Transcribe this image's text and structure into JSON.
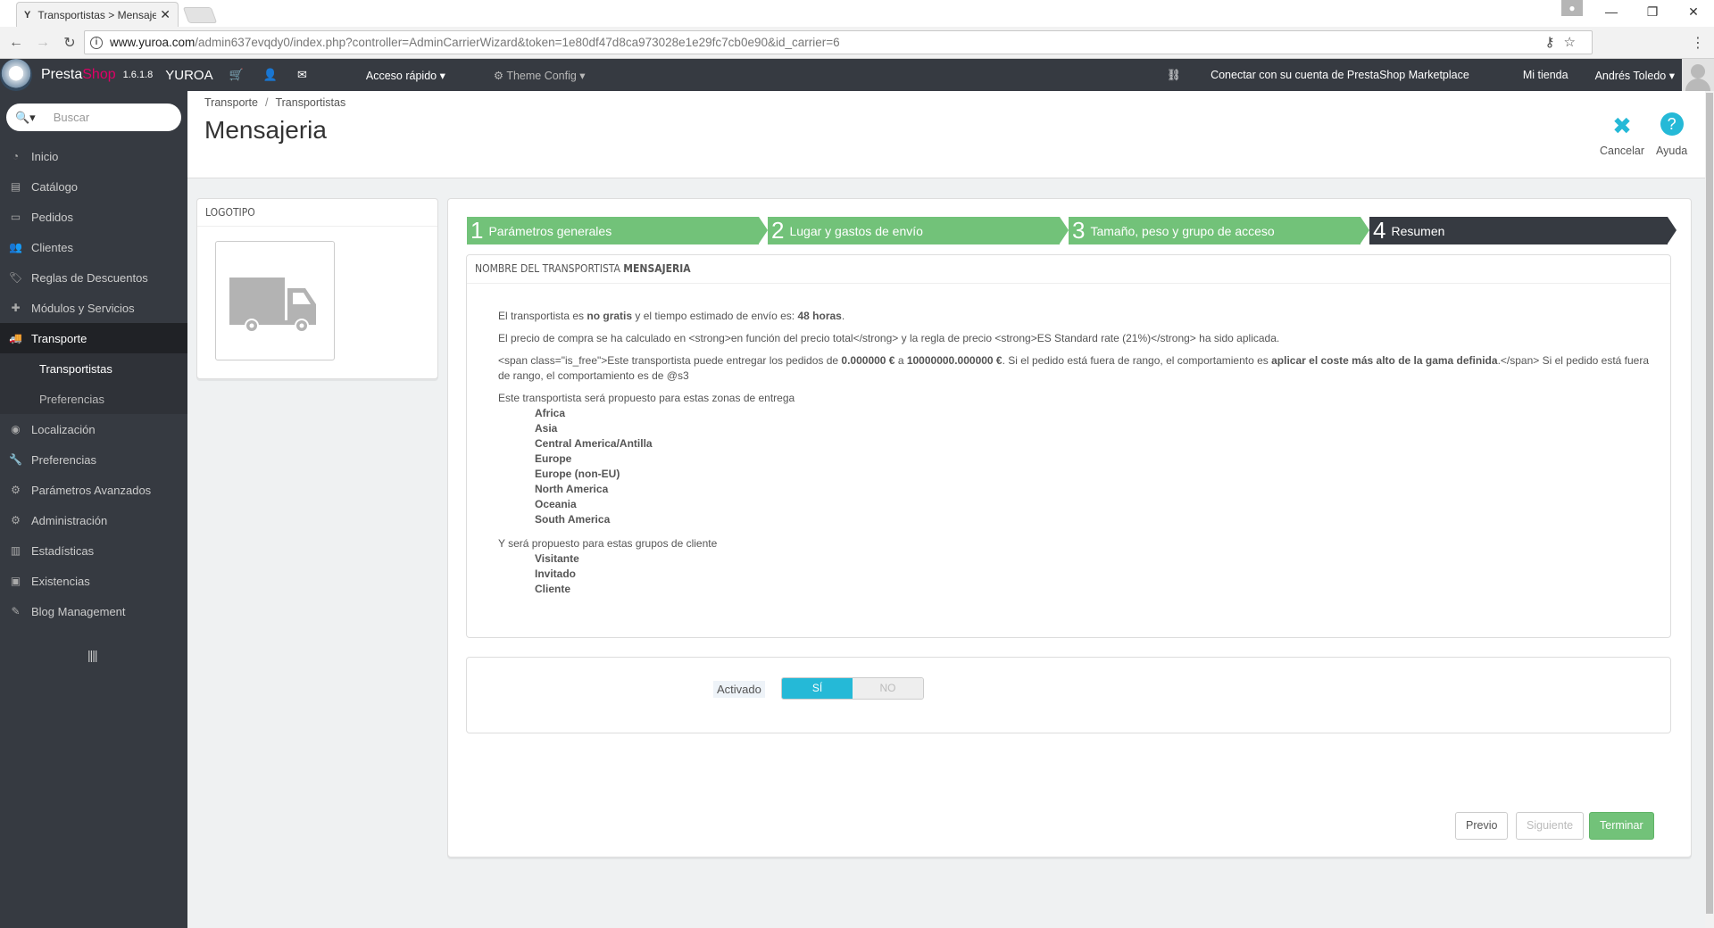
{
  "browser": {
    "tab_title": "Transportistas > Mensaje",
    "tab_favicon": "Y",
    "url_host": "www.yuroa.com",
    "url_path": "/admin637evqdy0/index.php?controller=AdminCarrierWizard&token=1e80df47d8ca973028e1e29fc7cb0e90&id_carrier=6"
  },
  "header": {
    "brand_presta": "Presta",
    "brand_shop": "Shop",
    "version": "1.6.1.8",
    "shop_name": "YUROA",
    "quick_access": "Acceso rápido ▾",
    "theme_config": "⚙ Theme Config ▾",
    "marketplace": "Conectar con su cuenta de PrestaShop Marketplace",
    "my_shop": "Mi tienda",
    "user": "Andrés Toledo ▾"
  },
  "sidebar": {
    "search_placeholder": "Buscar",
    "items": [
      {
        "label": "Inicio"
      },
      {
        "label": "Catálogo"
      },
      {
        "label": "Pedidos"
      },
      {
        "label": "Clientes"
      },
      {
        "label": "Reglas de Descuentos"
      },
      {
        "label": "Módulos y Servicios"
      },
      {
        "label": "Transporte"
      },
      {
        "label": "Localización"
      },
      {
        "label": "Preferencias"
      },
      {
        "label": "Parámetros Avanzados"
      },
      {
        "label": "Administración"
      },
      {
        "label": "Estadísticas"
      },
      {
        "label": "Existencias"
      },
      {
        "label": "Blog Management"
      }
    ],
    "sub_items": [
      {
        "label": "Transportistas"
      },
      {
        "label": "Preferencias"
      }
    ]
  },
  "page": {
    "breadcrumb_1": "Transporte",
    "breadcrumb_2": "Transportistas",
    "title": "Mensajeria",
    "cancel_label": "Cancelar",
    "help_label": "Ayuda"
  },
  "logo_panel": {
    "heading": "LOGOTIPO"
  },
  "wizard": {
    "steps": [
      {
        "num": "1",
        "label": "Parámetros generales"
      },
      {
        "num": "2",
        "label": "Lugar y gastos de envío"
      },
      {
        "num": "3",
        "label": "Tamaño, peso y grupo de acceso"
      },
      {
        "num": "4",
        "label": "Resumen"
      }
    ],
    "summary_heading_prefix": "NOMBRE DEL TRANSPORTISTA",
    "summary_heading_name": "MENSAJERIA",
    "line1_a": "El transportista es ",
    "line1_b": "no gratis",
    "line1_c": " y el tiempo estimado de envío es: ",
    "line1_d": "48 horas",
    "line1_e": ".",
    "line2": "El precio de compra se ha calculado en <strong>en función del precio total</strong> y la regla de precio <strong>ES Standard rate (21%)</strong> ha sido aplicada.",
    "line3_a": "<span class=\"is_free\">Este transportista puede entregar los pedidos de ",
    "line3_b": "0.000000 €",
    "line3_c": " a ",
    "line3_d": "10000000.000000 €",
    "line3_e": ". Si el pedido está fuera de rango, el comportamiento es ",
    "line3_f": "aplicar el coste más alto de la gama definida",
    "line3_g": ".</span> Si el pedido está fuera de rango, el comportamiento es de @s3",
    "zones_intro": "Este transportista será propuesto para estas zonas de entrega",
    "zones": [
      "Africa",
      "Asia",
      "Central America/Antilla",
      "Europe",
      "Europe (non-EU)",
      "North America",
      "Oceania",
      "South America"
    ],
    "groups_intro": "Y será propuesto para estas grupos de cliente",
    "groups": [
      "Visitante",
      "Invitado",
      "Cliente"
    ],
    "active_label": "Activado",
    "yes": "SÍ",
    "no": "NO",
    "prev": "Previo",
    "next": "Siguiente",
    "finish": "Terminar"
  }
}
